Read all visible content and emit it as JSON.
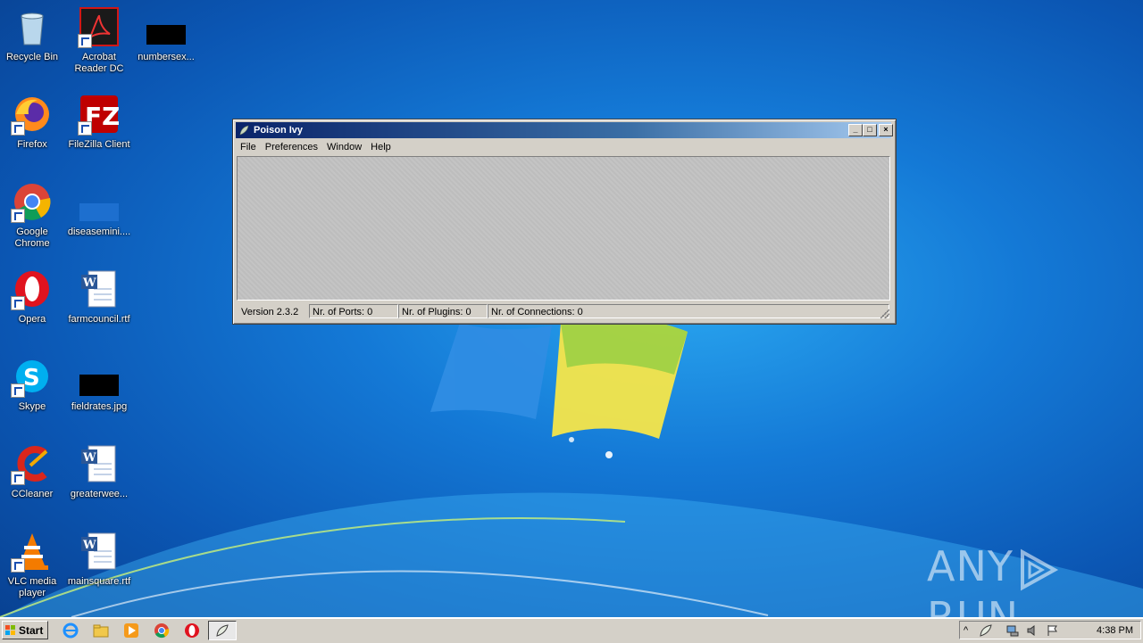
{
  "desktop": {
    "icons": [
      {
        "label": "Recycle Bin"
      },
      {
        "label": "Acrobat Reader DC"
      },
      {
        "label": "numbersex..."
      },
      {
        "label": "Firefox"
      },
      {
        "label": "FileZilla Client"
      },
      {
        "label": "Google Chrome"
      },
      {
        "label": "diseasemini...."
      },
      {
        "label": "Opera"
      },
      {
        "label": "farmcouncil.rtf"
      },
      {
        "label": "Skype"
      },
      {
        "label": "fieldrates.jpg"
      },
      {
        "label": "CCleaner"
      },
      {
        "label": "greaterwee..."
      },
      {
        "label": "VLC media player"
      },
      {
        "label": "mainsquare.rtf"
      }
    ]
  },
  "window": {
    "title": "Poison Ivy",
    "menu": [
      "File",
      "Preferences",
      "Window",
      "Help"
    ],
    "status": {
      "version": "Version 2.3.2",
      "ports": "Nr. of Ports: 0",
      "plugins": "Nr. of Plugins: 0",
      "connections": "Nr. of Connections: 0"
    }
  },
  "taskbar": {
    "start_label": "Start",
    "clock": "4:38 PM"
  },
  "watermark": {
    "text_left": "ANY",
    "text_right": "RUN"
  },
  "colors": {
    "titlebar_start": "#0a246a",
    "titlebar_end": "#a6caf0",
    "chrome": "#d4d0c8"
  }
}
